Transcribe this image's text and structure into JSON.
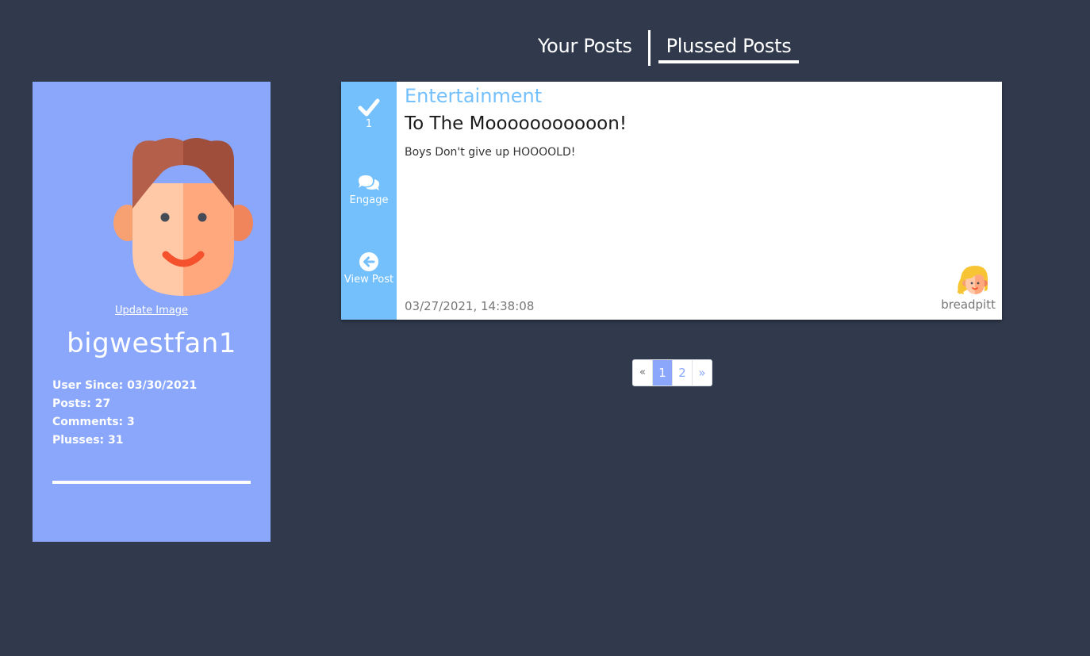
{
  "tabs": [
    {
      "label": "Your Posts",
      "active": false
    },
    {
      "label": "Plussed Posts",
      "active": true
    }
  ],
  "profile": {
    "update_image": "Update Image",
    "username": "bigwestfan1",
    "stats": {
      "user_since": "User Since: 03/30/2021",
      "posts": "Posts: 27",
      "comments": "Comments: 3",
      "plusses": "Plusses: 31"
    },
    "bg_color": "#8aa7fb"
  },
  "post": {
    "plus_count": "1",
    "engage_label": "Engage",
    "view_label": "View Post",
    "category": "Entertainment",
    "title": "To The Mooooooooooon!",
    "body": "Boys Don't give up HOOOOLD!",
    "date": "03/27/2021, 14:38:08",
    "author": "breadpitt",
    "accent_color": "#74c0fc"
  },
  "pagination": {
    "prev": "«",
    "pages": [
      "1",
      "2"
    ],
    "active_page": "1",
    "next": "»"
  },
  "icons": {
    "plus": "check-icon",
    "engage": "comments-icon",
    "view": "arrow-left-circle-icon"
  }
}
